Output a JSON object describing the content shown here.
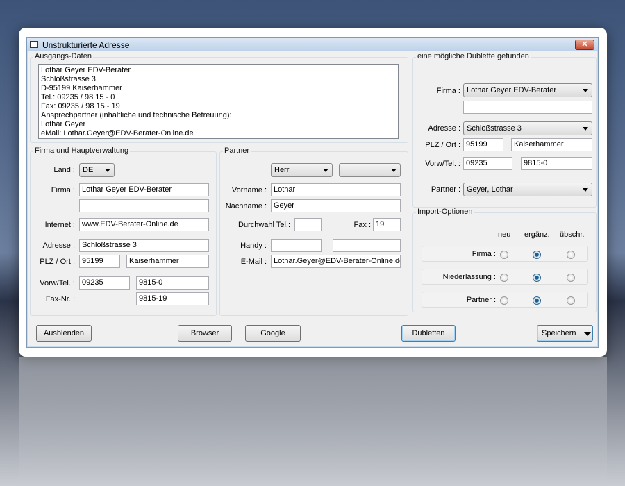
{
  "window": {
    "title": "Unstrukturierte Adresse",
    "close": "✕"
  },
  "source": {
    "label": "Ausgangs-Daten",
    "text": "Lothar Geyer EDV-Berater\nSchloßstrasse 3\nD-95199 Kaiserhammer\nTel.: 09235 / 98 15 - 0\nFax: 09235 / 98 15 - 19\nAnsprechpartner (inhaltliche und technische Betreuung):\nLothar Geyer\neMail: Lothar.Geyer@EDV-Berater-Online.de"
  },
  "company": {
    "label": "Firma und Hauptverwaltung",
    "land_label": "Land :",
    "land": "DE",
    "firma_label": "Firma :",
    "firma": "Lothar Geyer EDV-Berater",
    "firma2": "",
    "internet_label": "Internet :",
    "internet": "www.EDV-Berater-Online.de",
    "adresse_label": "Adresse :",
    "adresse": "Schloßstrasse 3",
    "plz_label": "PLZ / Ort :",
    "plz": "95199",
    "ort": "Kaiserhammer",
    "tel_label": "Vorw/Tel. :",
    "vorwahl": "09235",
    "tel": "9815-0",
    "fax_label": "Fax-Nr. :",
    "fax": "9815-19"
  },
  "partner": {
    "label": "Partner",
    "anrede": "Herr",
    "titel": "",
    "vorname_label": "Vorname :",
    "vorname": "Lothar",
    "nachname_label": "Nachname :",
    "nachname": "Geyer",
    "durchwahl_label": "Durchwahl Tel.:",
    "durchwahl": "",
    "fax_label": "Fax :",
    "fax": "19",
    "handy_label": "Handy :",
    "handy1": "",
    "handy2": "",
    "email_label": "E-Mail :",
    "email": "Lothar.Geyer@EDV-Berater-Online.de"
  },
  "duplicate": {
    "label": "eine mögliche Dublette gefunden",
    "firma_label": "Firma :",
    "firma": "Lothar Geyer EDV-Berater",
    "firma2": "",
    "adresse_label": "Adresse :",
    "adresse": "Schloßstrasse 3",
    "plz_label": "PLZ / Ort :",
    "plz": "95199",
    "ort": "Kaiserhammer",
    "tel_label": "Vorw/Tel. :",
    "vorwahl": "09235",
    "tel": "9815-0",
    "partner_label": "Partner :",
    "partner": "Geyer, Lothar"
  },
  "import": {
    "label": "Import-Optionen",
    "columns": [
      "neu",
      "ergänz.",
      "übschr."
    ],
    "rows": [
      {
        "label": "Firma :",
        "selected": 1
      },
      {
        "label": "Niederlassung :",
        "selected": 1
      },
      {
        "label": "Partner :",
        "selected": 1
      }
    ]
  },
  "buttons": {
    "hide": "Ausblenden",
    "browser": "Browser",
    "google": "Google",
    "duplicates": "Dubletten",
    "save": "Speichern"
  }
}
